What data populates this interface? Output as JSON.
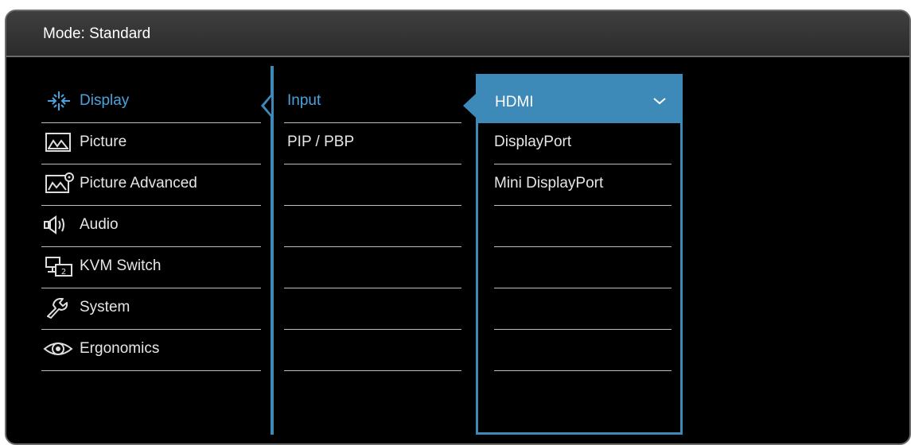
{
  "header": {
    "title": "Mode: Standard"
  },
  "main_menu": [
    {
      "label": "Display",
      "icon": "display-icon",
      "selected": true
    },
    {
      "label": "Picture",
      "icon": "picture-icon"
    },
    {
      "label": "Picture Advanced",
      "icon": "picture-advanced-icon"
    },
    {
      "label": "Audio",
      "icon": "audio-icon"
    },
    {
      "label": "KVM Switch",
      "icon": "kvm-switch-icon"
    },
    {
      "label": "System",
      "icon": "system-icon"
    },
    {
      "label": "Ergonomics",
      "icon": "ergonomics-icon"
    }
  ],
  "sub_menu": [
    {
      "label": "Input",
      "selected": true
    },
    {
      "label": "PIP / PBP"
    },
    {
      "label": ""
    },
    {
      "label": ""
    },
    {
      "label": ""
    },
    {
      "label": ""
    },
    {
      "label": ""
    }
  ],
  "options": {
    "selected": "HDMI",
    "items": [
      "DisplayPort",
      "Mini DisplayPort",
      "",
      "",
      "",
      "",
      ""
    ]
  },
  "colors": {
    "accent": "#3d8ab8",
    "selected_text": "#4aa3dc",
    "background": "#000000"
  }
}
